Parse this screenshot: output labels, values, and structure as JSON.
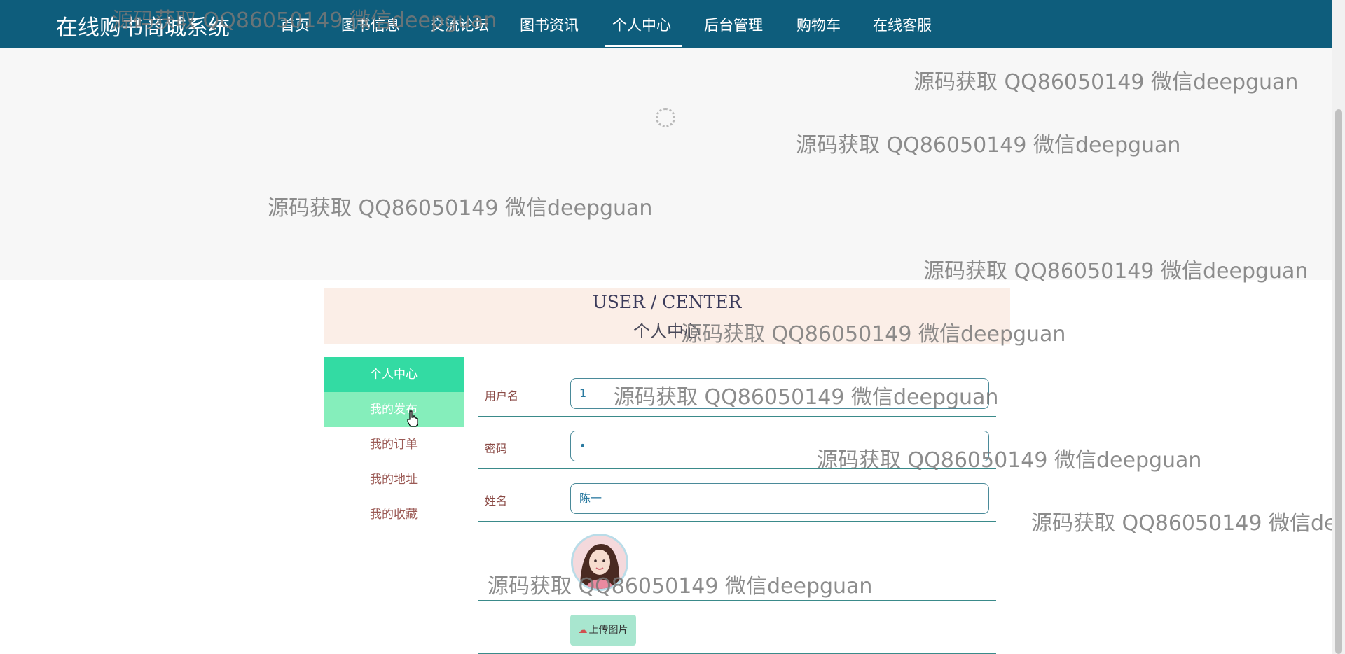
{
  "brand": "在线购书商城系统",
  "nav": [
    "首页",
    "图书信息",
    "交流论坛",
    "图书资讯",
    "个人中心",
    "后台管理",
    "购物车",
    "在线客服"
  ],
  "title_en": "USER / CENTER",
  "title_cn": "个人中心",
  "side_menu": [
    "个人中心",
    "我的发布",
    "我的订单",
    "我的地址",
    "我的收藏"
  ],
  "form": {
    "username_label": "用户名",
    "username_value": "1",
    "password_label": "密码",
    "password_value": "•",
    "name_label": "姓名",
    "name_value": "陈一"
  },
  "upload_label": "上传图片",
  "watermark": "源码获取 QQ86050149 微信deepguan",
  "colors": {
    "nav_bg": "#0e5d7c",
    "menu_active": "#33dba3",
    "menu_hover": "#85eebb",
    "title_strip": "#fbeee7",
    "upload_btn": "#a8e6cf"
  },
  "icons": [
    "loading-spinner-icon",
    "cloud-upload-icon",
    "pointer-cursor-icon"
  ]
}
